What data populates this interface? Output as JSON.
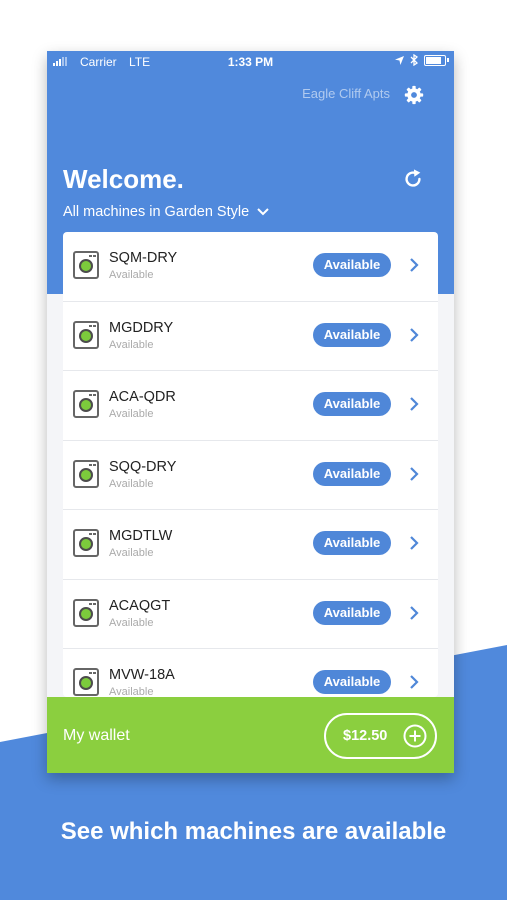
{
  "colors": {
    "header_blue": "#5089dc",
    "badge_blue": "#4f87d8",
    "wallet_green": "#8bcf3f",
    "drum_green": "#7ccb3c"
  },
  "status_bar": {
    "carrier": "Carrier",
    "network": "LTE",
    "time": "1:33 PM"
  },
  "header": {
    "property": "Eagle Cliff Apts",
    "welcome": "Welcome.",
    "filter": "All machines in Garden Style"
  },
  "machines": [
    {
      "name": "SQM-DRY",
      "status": "Available",
      "badge": "Available"
    },
    {
      "name": "MGDDRY",
      "status": "Available",
      "badge": "Available"
    },
    {
      "name": "ACA-QDR",
      "status": "Available",
      "badge": "Available"
    },
    {
      "name": "SQQ-DRY",
      "status": "Available",
      "badge": "Available"
    },
    {
      "name": "MGDTLW",
      "status": "Available",
      "badge": "Available"
    },
    {
      "name": "ACAQGT",
      "status": "Available",
      "badge": "Available"
    },
    {
      "name": "MVW-18A",
      "status": "Available",
      "badge": "Available"
    }
  ],
  "wallet": {
    "label": "My wallet",
    "amount": "$12.50"
  },
  "tagline": "See which machines are available"
}
